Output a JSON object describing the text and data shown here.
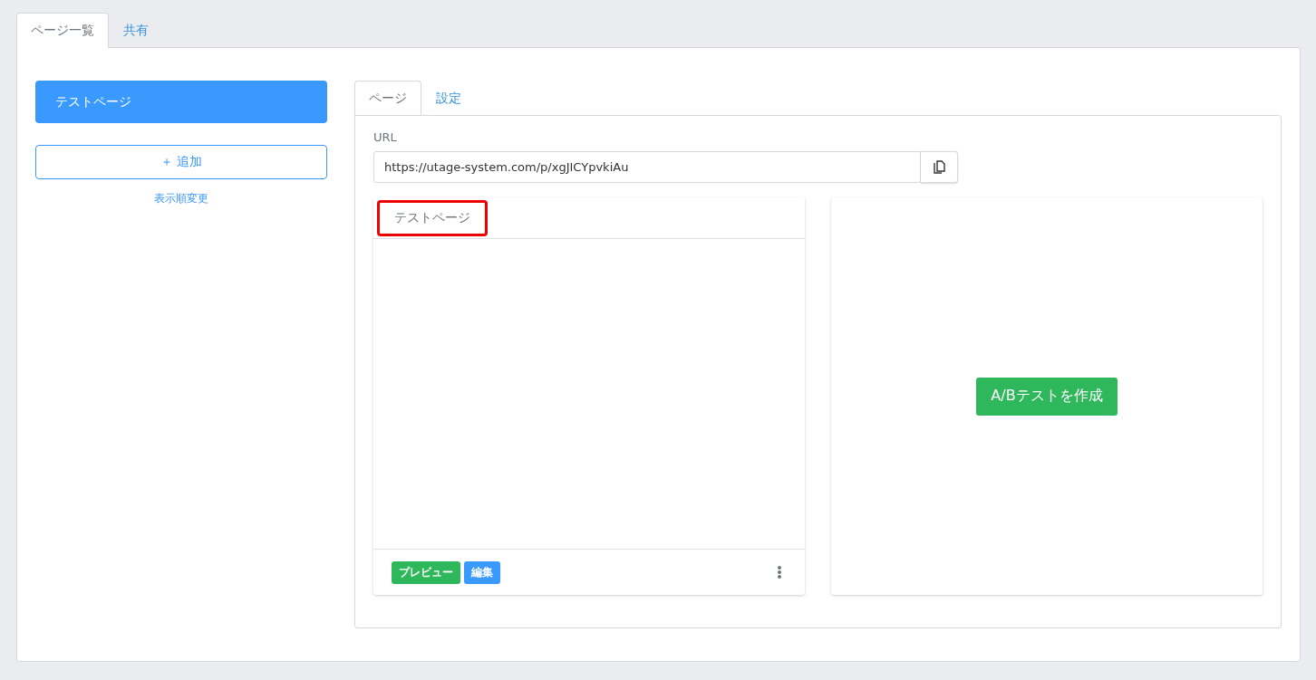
{
  "top_tabs": [
    {
      "label": "ページ一覧",
      "selected": true
    },
    {
      "label": "共有",
      "selected": false
    }
  ],
  "sidebar": {
    "items": [
      {
        "label": "テストページ",
        "selected": true
      }
    ],
    "add_button": "＋ 追加",
    "reorder_link": "表示順変更"
  },
  "detail_tabs": [
    {
      "label": "ページ",
      "selected": true
    },
    {
      "label": "設定",
      "selected": false
    }
  ],
  "url": {
    "label": "URL",
    "value": "https://utage-system.com/p/xgJICYpvkiAu"
  },
  "page_card": {
    "title": "テストページ",
    "title_highlighted": true,
    "buttons": [
      {
        "label": "プレビュー",
        "kind": "success"
      },
      {
        "label": "編集",
        "kind": "primary"
      }
    ]
  },
  "ab_card": {
    "button": "A/Bテストを作成"
  }
}
